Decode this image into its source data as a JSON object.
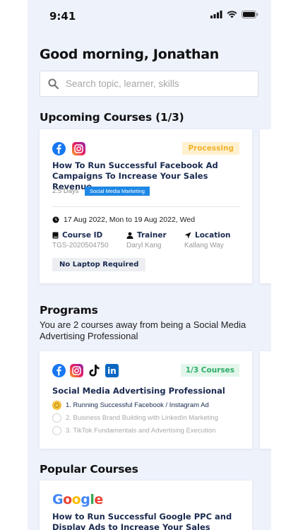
{
  "status_bar": {
    "time": "9:41"
  },
  "greeting": "Good morning, Jonathan",
  "search": {
    "placeholder": "Search topic, learner, skills"
  },
  "upcoming": {
    "title": "Upcoming Courses (1/3)",
    "course": {
      "status": "Processing",
      "title": "How To Run Successful Facebook Ad Campaigns To Increase Your Sales Revenue",
      "duration": "2.5 Days",
      "tag": "Social Media Marketing",
      "date": "17 Aug 2022, Mon to 19 Aug 2022, Wed",
      "course_id_label": "Course ID",
      "course_id_value": "TGS-2020504750",
      "trainer_label": "Trainer",
      "trainer_value": "Daryl Kang",
      "location_label": "Location",
      "location_value": "Kallang Way",
      "requirement": "No Laptop Required"
    }
  },
  "programs": {
    "title": "Programs",
    "subtitle": "You are 2 courses away from  being a Social Media Advertising Professional",
    "program": {
      "progress": "1/3 Courses",
      "title": "Social Media Advertising Professional",
      "steps": [
        "1. Running Successful Facebook / Instagram Ad",
        "2. Business Brand Building with LinkedIn Marketing",
        "3. TikTok Fundamentals and Advertising Execution"
      ]
    }
  },
  "popular": {
    "title": "Popular Courses",
    "course": {
      "logo_text": "Google",
      "title": "How to Run Successful Google PPC and Display Ads to Increase Your Sales"
    }
  },
  "colors": {
    "background": "#eef2fb",
    "navy_text": "#1a2a50",
    "processing": "#f2b22c",
    "success": "#2bae66",
    "tag_blue": "#1e88e5"
  }
}
